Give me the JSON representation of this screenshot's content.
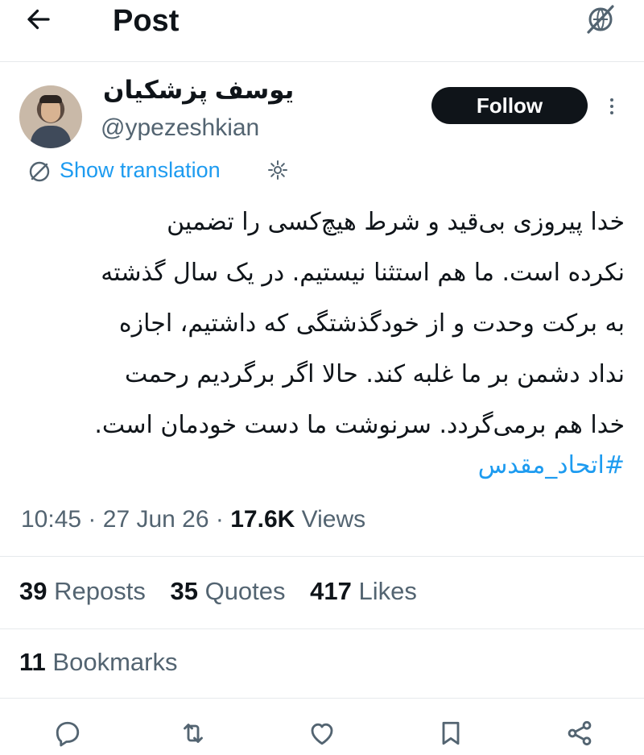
{
  "topbar": {
    "title": "Post",
    "back_icon": "arrow-left-icon",
    "right_icon": "no-translate-icon"
  },
  "author": {
    "name": "یوسف پزشکیان",
    "handle": "@ypezeshkian",
    "follow_label": "Follow"
  },
  "translation": {
    "label": "Show translation",
    "icon": "translate-icon",
    "settings_icon": "gear-icon"
  },
  "post": {
    "lines": [
      "خدا پیروزی بی‌قید و شرط هیچ‌کسی را تضمین",
      "نکرده است. ما هم استثنا نیستیم. در یک سال گذشته",
      "به برکت وحدت و از خودگذشتگی که داشتیم، اجازه",
      "نداد دشمن بر ما غلبه کند. حالا اگر برگردیم رحمت",
      "خدا هم برمی‌گردد. سرنوشت ما دست خودمان است."
    ],
    "hashtag": "#اتحاد_مقدس",
    "time": "10:45",
    "date": "27 Jun 26",
    "separator": "·",
    "views_count": "17.6K",
    "views_label": "Views"
  },
  "stats": {
    "reposts_count": "39",
    "reposts_label": "Reposts",
    "quotes_count": "35",
    "quotes_label": "Quotes",
    "likes_count": "417",
    "likes_label": "Likes",
    "bookmarks_count": "11",
    "bookmarks_label": "Bookmarks"
  },
  "actions": [
    "reply-icon",
    "repost-icon",
    "like-icon",
    "bookmark-icon",
    "share-icon"
  ],
  "colors": {
    "accent": "#1d9bf0",
    "text": "#0f1419",
    "secondary": "#536471",
    "follow_bg": "#0f1419"
  }
}
